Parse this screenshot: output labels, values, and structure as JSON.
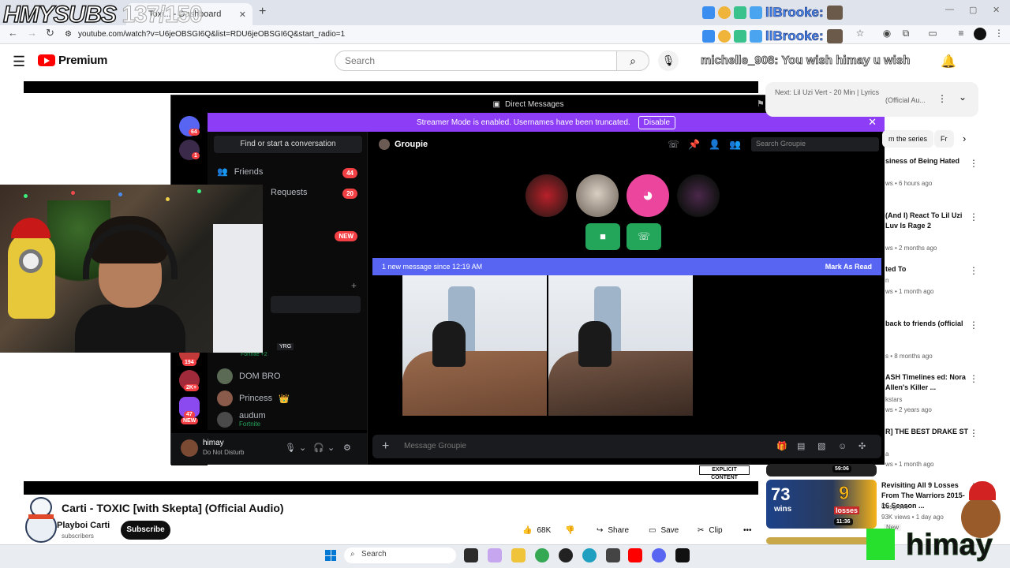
{
  "browser": {
    "tab_title": "Toxi... - Dashboard",
    "url": "youtube.com/watch?v=U6jeOBSGI6Q&list=RDU6jeOBSGI6Q&start_radio=1"
  },
  "overlay": {
    "hmysubs": "HMYSUBS",
    "sub_count": "137/150",
    "streamer_tag": "llBrooke:",
    "chat_user": "michelle_908:",
    "chat_message": "You wish himay u wish",
    "brand": "himay"
  },
  "youtube": {
    "logo_text": "Premium",
    "search_placeholder": "Search",
    "video_title": "Carti - TOXIC [with Skepta] (Official Audio)",
    "channel": "Playboi Carti",
    "subscribers": "subscribers",
    "subscribe_label": "Subscribe",
    "likes": "68K",
    "share_label": "Share",
    "save_label": "Save",
    "clip_label": "Clip",
    "explicit_label": "EXPLICIT CONTENT"
  },
  "discord": {
    "window_title": "Direct Messages",
    "streamer_mode_text": "Streamer Mode is enabled. Usernames have been truncated.",
    "disable_label": "Disable",
    "find_placeholder": "Find or start a conversation",
    "friends_label": "Friends",
    "friends_count": "44",
    "requests_label": "Requests",
    "requests_count": "20",
    "new_badge": "NEW",
    "dms": [
      {
        "name": "DOM BRO",
        "sub": ""
      },
      {
        "name": "Princess",
        "sub": ""
      },
      {
        "name": "audum",
        "sub": "Fortnite"
      }
    ],
    "fortnite_sub": "Fortnite +2",
    "yrg_tag": "YRG",
    "guild_badges": [
      "64",
      "1",
      "194",
      "2K+",
      "47"
    ],
    "guild_new": "NEW",
    "user_name": "himay",
    "user_status": "Do Not Disturb",
    "chat_name": "Groupie",
    "chat_search": "Search Groupie",
    "new_message_bar": "1 new message since 12:19 AM",
    "mark_as_read": "Mark As Read",
    "composer_placeholder": "Message Groupie"
  },
  "sidebar": {
    "up_next": "Next: Lil Uzi Vert - 20 Min | Lyrics",
    "up_next_sub": "(Official Au...",
    "chips": [
      "m the series",
      "Fr"
    ],
    "recs": [
      {
        "title": "siness of Being Hated",
        "meta": "ws • 6 hours ago"
      },
      {
        "title": "(And I) React To Lil Uzi Luv Is Rage 2",
        "meta": "ws • 2 months ago"
      },
      {
        "title": "ted To",
        "meta": "n",
        "meta2": "ws • 1 month ago"
      },
      {
        "title": "back to friends (official",
        "meta": "s • 8 months ago"
      },
      {
        "title": "ASH Timelines ed: Nora Allen's Killer ...",
        "meta": "kstars",
        "meta2": "ws • 2 years ago"
      },
      {
        "title": "R] THE BEST DRAKE ST",
        "meta": "a",
        "meta2": "ws • 1 month ago"
      },
      {
        "title": "Revisiting All 9 Losses From The Warriors 2015-16 Season ...",
        "meta": "Cosgrove",
        "meta2": "93K views • 1 day ago",
        "badge": "New"
      }
    ],
    "durations": [
      "59:06",
      "11:36"
    ],
    "thumb_text_73": "73",
    "thumb_text_wins": "wins",
    "thumb_text_9": "9",
    "thumb_text_losses": "losses"
  },
  "taskbar": {
    "search": "Search"
  },
  "colors": {
    "discord_purple": "#8c3df5",
    "discord_blurple": "#5865f2",
    "yt_red": "#ff0000",
    "call_green": "#23a55a"
  }
}
